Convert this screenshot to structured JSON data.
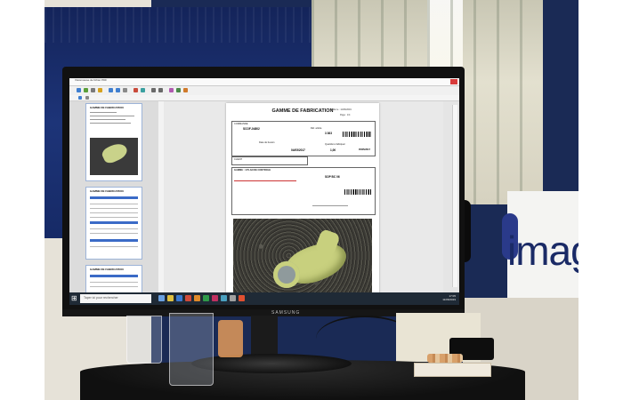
{
  "scene": {
    "description_free": true,
    "booth_brand_text": "imag",
    "monitor_brand": "SAMSUNG"
  },
  "app": {
    "window_title": "Visionneuse de fichier PDF",
    "document": {
      "title": "GAMME DE FABRICATION",
      "header_date": "Edité le : 11/06/2019",
      "header_page": "Page : 1/4",
      "fields": {
        "commande_label": "COMMANDE",
        "commande_value": "SCOF-04802",
        "ref_label": "Réf. article",
        "ref_value": "3 363",
        "qty_label": "Quantité à fabriquer",
        "qty_value": "1,00",
        "date_label": "Date de besoin",
        "date_value": "05/05/2017",
        "launch_value": "04/05/2017",
        "client_label": "CLIENT",
        "gamme_label": "GAMME : 4 PLAN DE CONTROLE",
        "op_value": "SOP BC 06"
      }
    },
    "thumbnails": [
      {
        "title": "GAMME DE FABRICATION"
      },
      {
        "title": "GAMME DE FABRICATION"
      },
      {
        "title": "GAMME DE FABRICATION"
      }
    ],
    "taskbar": {
      "search_placeholder": "Taper ici pour rechercher",
      "time": "17:05",
      "date": "11/06/2019"
    }
  },
  "colors": {
    "window_close": "#d83b3b",
    "taskbar": "#1f2a36",
    "part_green": "#c8d07e",
    "banner_blue": "#14245a"
  }
}
